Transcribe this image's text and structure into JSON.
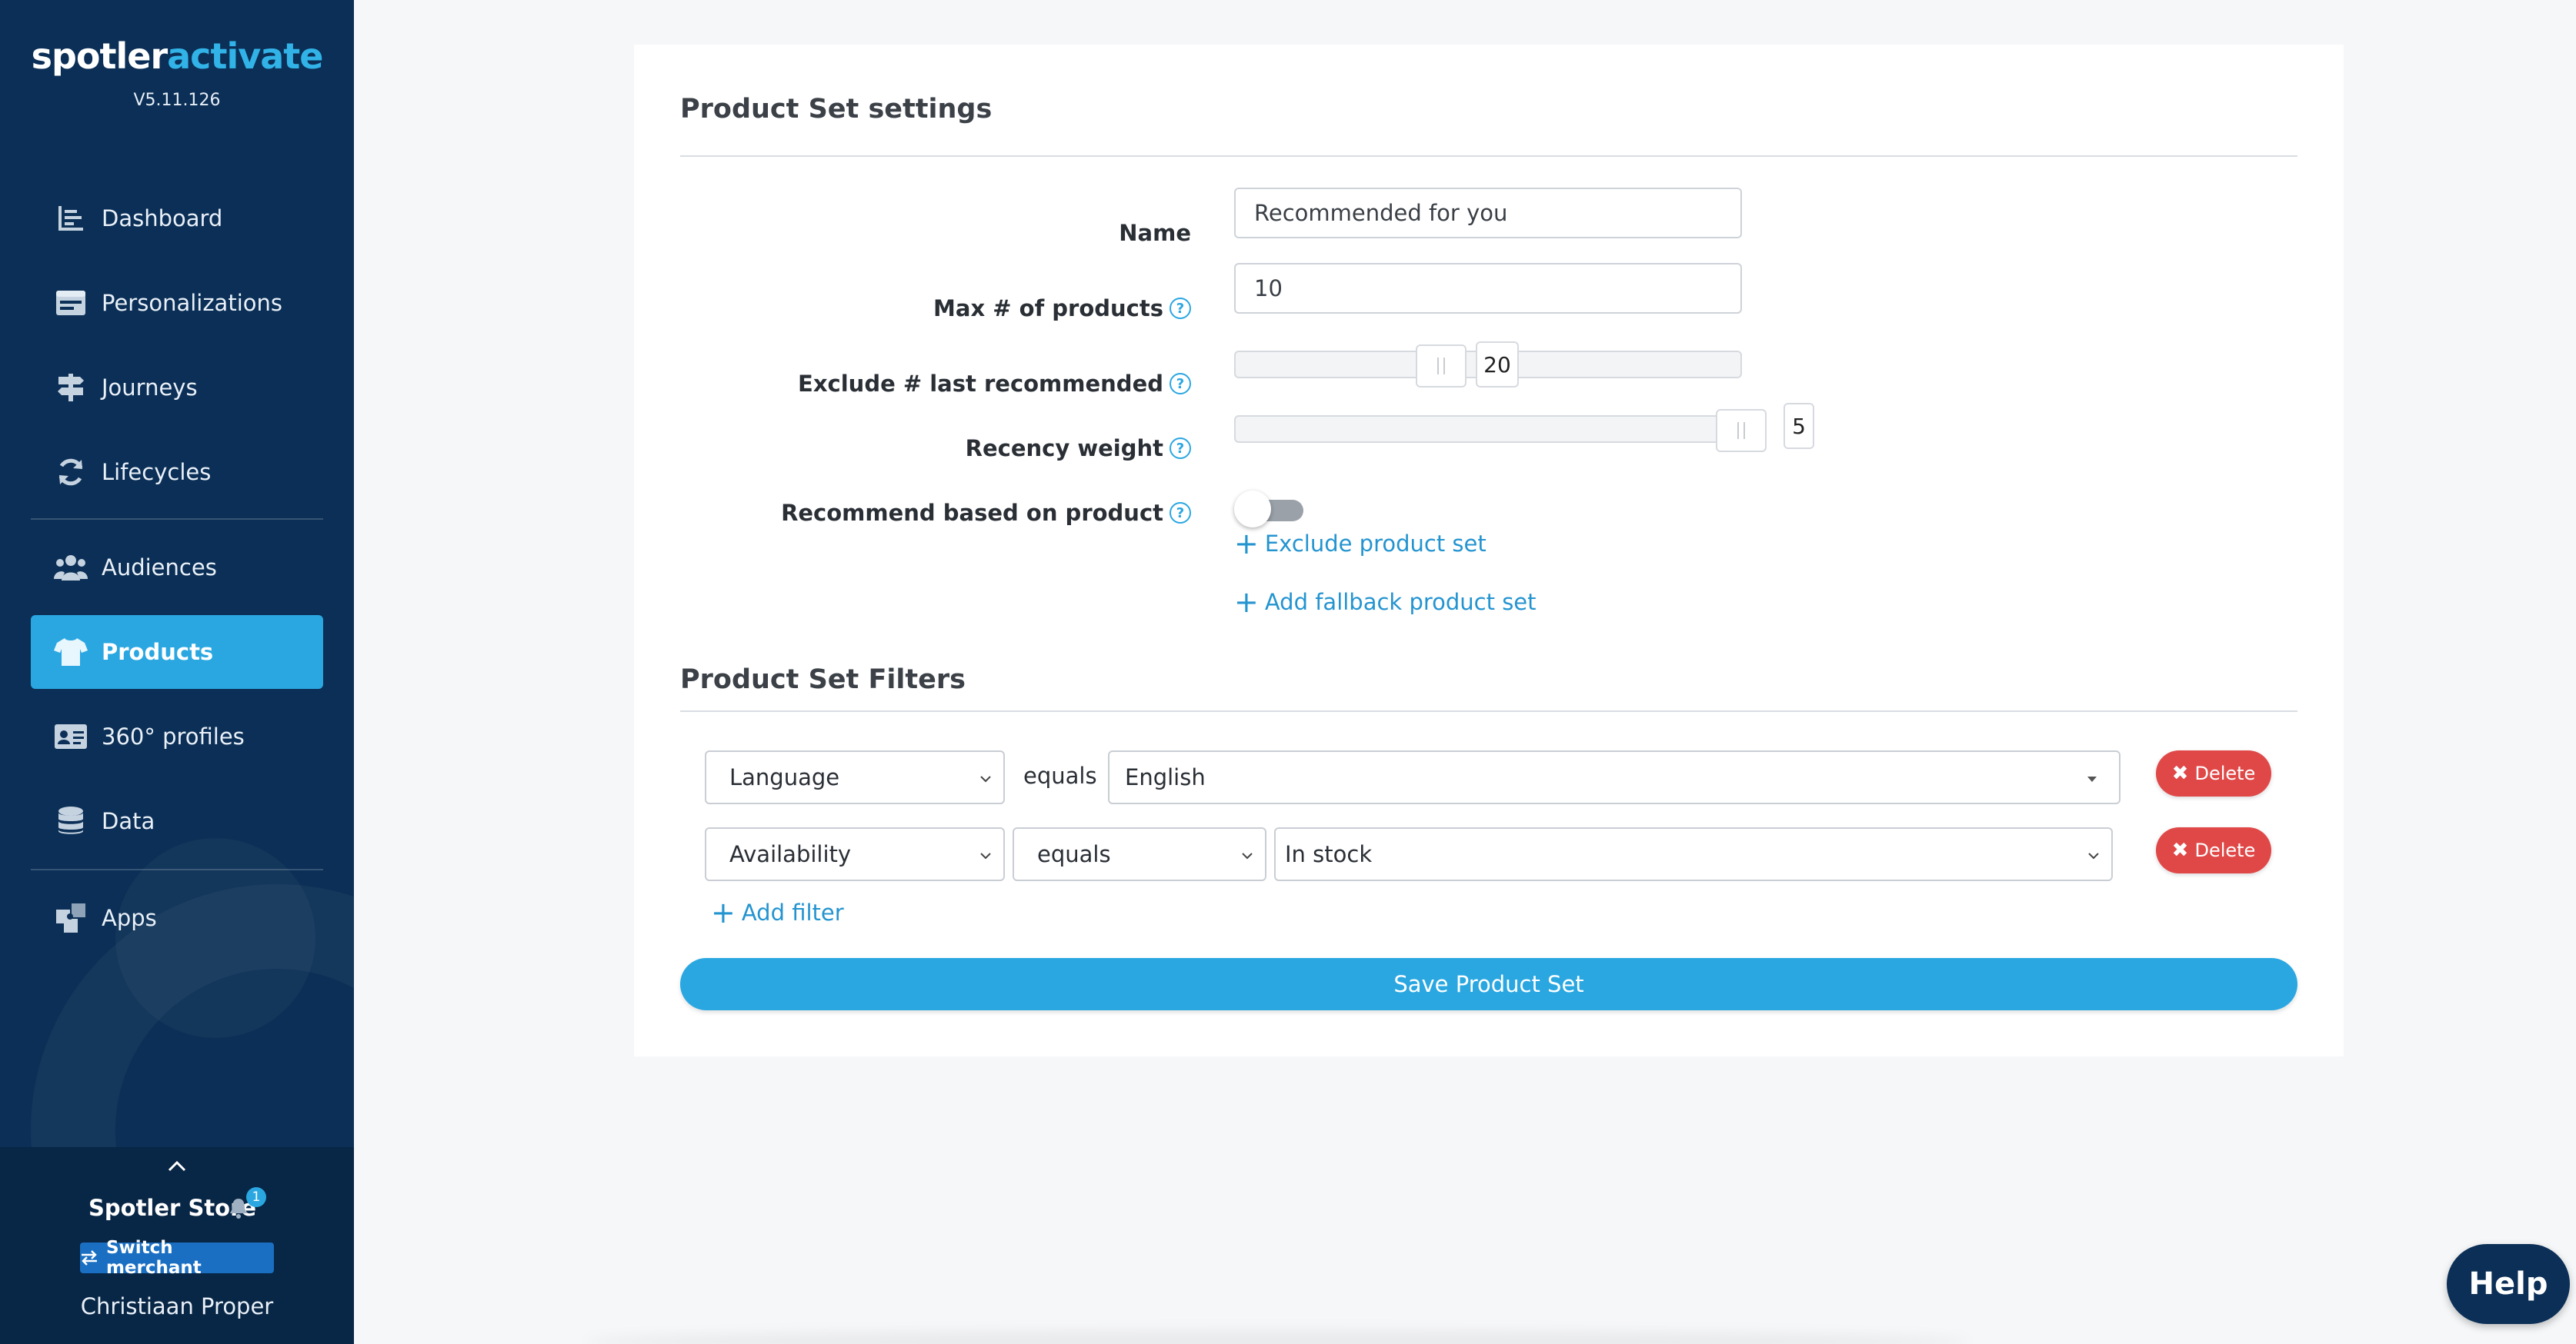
{
  "sidebar": {
    "logo_part1": "spotler",
    "logo_part2": "activate",
    "version": "V5.11.126",
    "items": [
      {
        "label": "Dashboard",
        "icon": "dashboard-icon"
      },
      {
        "label": "Personalizations",
        "icon": "personalizations-icon"
      },
      {
        "label": "Journeys",
        "icon": "signpost-icon"
      },
      {
        "label": "Lifecycles",
        "icon": "refresh-icon"
      },
      {
        "label": "Audiences",
        "icon": "users-icon"
      },
      {
        "label": "Products",
        "icon": "tshirt-icon",
        "active": true
      },
      {
        "label": "360° profiles",
        "icon": "id-card-icon"
      },
      {
        "label": "Data",
        "icon": "database-icon"
      },
      {
        "label": "Apps",
        "icon": "puzzle-icon"
      }
    ],
    "store_name": "Spotler Store",
    "notification_count": "1",
    "switch_label": "Switch merchant",
    "user_name": "Christiaan Proper"
  },
  "settings": {
    "title": "Product Set settings",
    "name_label": "Name",
    "name_value": "Recommended for you",
    "max_label": "Max # of products",
    "max_value": "10",
    "exclude_label": "Exclude # last recommended",
    "exclude_value": "20",
    "recency_label": "Recency weight",
    "recency_value": "5",
    "recommend_label": "Recommend based on product",
    "recommend_enabled": false,
    "exclude_set_link": "Exclude product set",
    "fallback_link": "Add fallback product set"
  },
  "filters": {
    "title": "Product Set Filters",
    "rows": [
      {
        "field": "Language",
        "operator": "equals",
        "value": "English",
        "delete_label": "Delete"
      },
      {
        "field": "Availability",
        "operator": "equals",
        "value": "In stock",
        "delete_label": "Delete"
      }
    ],
    "add_filter_label": "Add filter"
  },
  "save_label": "Save Product Set",
  "help_label": "Help",
  "colors": {
    "sidebar_bg": "#0b2f56",
    "accent": "#2aa7e1",
    "delete": "#e04848"
  }
}
